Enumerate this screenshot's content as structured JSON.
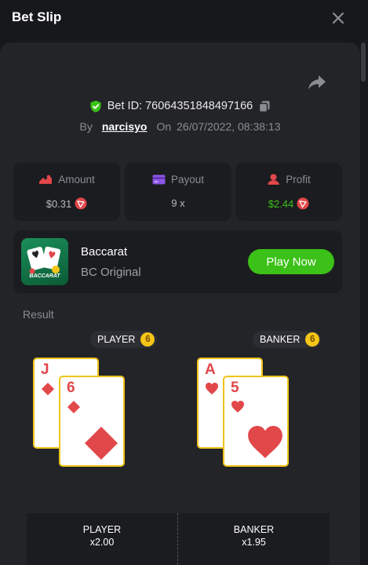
{
  "header": {
    "title": "Bet Slip"
  },
  "bet": {
    "id_label": "Bet ID: 76064351848497166",
    "by_label": "By",
    "user": "narcisyo",
    "on_label": "On",
    "date": "26/07/2022, 08:38:13"
  },
  "stats": [
    {
      "label": "Amount",
      "value": "$0.31",
      "icon": "amount-icon"
    },
    {
      "label": "Payout",
      "value": "9 x",
      "icon": "card-icon"
    },
    {
      "label": "Profit",
      "value": "$2.44",
      "icon": "profit-icon"
    }
  ],
  "game": {
    "name": "Baccarat",
    "subtitle": "BC Original",
    "play_label": "Play Now",
    "thumb_text": "BACCARAT"
  },
  "result": {
    "label": "Result",
    "player": {
      "label": "PLAYER",
      "score": "6",
      "cards": [
        {
          "rank": "J",
          "suit": "diamond"
        },
        {
          "rank": "6",
          "suit": "diamond"
        }
      ]
    },
    "banker": {
      "label": "BANKER",
      "score": "6",
      "cards": [
        {
          "rank": "A",
          "suit": "heart"
        },
        {
          "rank": "5",
          "suit": "heart"
        }
      ]
    }
  },
  "bets": [
    {
      "label": "PLAYER",
      "mult": "x2.00"
    },
    {
      "label": "BANKER",
      "mult": "x1.95"
    }
  ],
  "colors": {
    "accent_green": "#3bc117",
    "card_red": "#e2474a",
    "card_border": "#f0c419",
    "badge_gold": "#f5c518"
  }
}
